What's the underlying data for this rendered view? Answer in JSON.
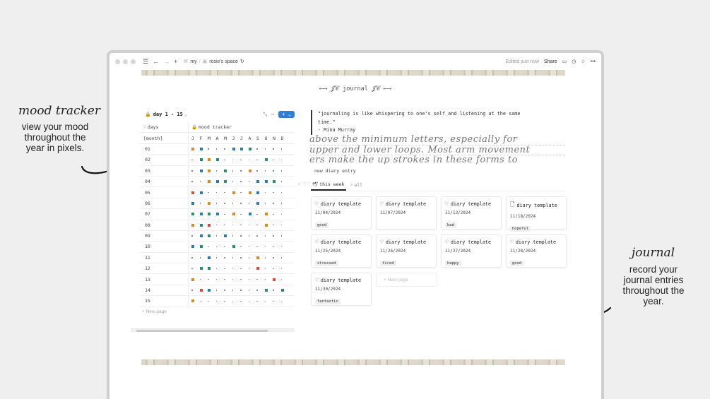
{
  "annotations": {
    "left_title": "mood tracker",
    "left_body": [
      "view your mood",
      "throughout the",
      "year in pixels."
    ],
    "right_title": "journal",
    "right_body": [
      "record your",
      "journal entries",
      "throughout the",
      "year."
    ]
  },
  "topbar": {
    "breadcrumb_1": "my",
    "breadcrumb_sep": "/",
    "breadcrumb_2": "rosie's space",
    "edited": "Edited just now",
    "share": "Share"
  },
  "page_title": "⟵⟶ 𝒥𝒞 journal 𝒥𝒞 ⟵⟶",
  "mood_db": {
    "view_name": "day 1 - 15",
    "new_label": "+",
    "col_days": "days",
    "col_mood": "mood tracker",
    "month_label": "[month]",
    "months": [
      "J",
      "F",
      "M",
      "A",
      "M",
      "J",
      "J",
      "A",
      "S",
      "O",
      "N",
      "D"
    ],
    "rows": [
      {
        "day": "01",
        "cells": [
          "orange",
          "blue",
          ".",
          ".",
          ".",
          "blue",
          "blue",
          "green",
          ".",
          ".",
          ".",
          "."
        ]
      },
      {
        "day": "02",
        "cells": [
          ".",
          "green",
          "orange",
          "green",
          ".",
          ".",
          ".",
          ".",
          ".",
          "green",
          ".",
          "."
        ]
      },
      {
        "day": "03",
        "cells": [
          ".",
          "blue",
          "orange",
          ".",
          "green",
          ".",
          ".",
          "orange",
          ".",
          ".",
          ".",
          "."
        ]
      },
      {
        "day": "04",
        "cells": [
          ".",
          ".",
          "orange",
          "blue",
          "green",
          ".",
          ".",
          ".",
          "blue",
          "blue",
          "green",
          "."
        ]
      },
      {
        "day": "05",
        "cells": [
          "red",
          "blue",
          ".",
          ".",
          ".",
          "orange",
          ".",
          "orange",
          "blue",
          ".",
          ".",
          "."
        ]
      },
      {
        "day": "06",
        "cells": [
          "blue",
          ".",
          "orange",
          ".",
          ".",
          ".",
          ".",
          ".",
          "blue",
          ".",
          ".",
          "."
        ]
      },
      {
        "day": "07",
        "cells": [
          "green",
          "blue",
          "green",
          "blue",
          ".",
          "orange",
          ".",
          "blue",
          ".",
          "orange",
          ".",
          "."
        ]
      },
      {
        "day": "08",
        "cells": [
          "orange",
          "green",
          "red",
          ".",
          ".",
          ".",
          ".",
          ".",
          ".",
          "orange",
          ".",
          "."
        ]
      },
      {
        "day": "09",
        "cells": [
          ".",
          "blue",
          "green",
          ".",
          "blue",
          ".",
          ".",
          ".",
          ".",
          ".",
          ".",
          "."
        ]
      },
      {
        "day": "10",
        "cells": [
          "blue",
          "green",
          ".",
          ".",
          ".",
          "green",
          ".",
          ".",
          ".",
          ".",
          ".",
          "."
        ]
      },
      {
        "day": "11",
        "cells": [
          ".",
          ".",
          "blue",
          ".",
          ".",
          ".",
          ".",
          ".",
          "orange",
          ".",
          ".",
          "."
        ]
      },
      {
        "day": "12",
        "cells": [
          ".",
          "green",
          "green",
          ".",
          ".",
          ".",
          ".",
          ".",
          "red",
          ".",
          ".",
          "."
        ]
      },
      {
        "day": "13",
        "cells": [
          "orange",
          ".",
          ".",
          ".",
          ".",
          ".",
          ".",
          ".",
          ".",
          ".",
          "red",
          "."
        ]
      },
      {
        "day": "14",
        "cells": [
          ".",
          "red",
          "blue",
          ".",
          ".",
          ".",
          ".",
          ".",
          ".",
          "green",
          ".",
          "green"
        ]
      },
      {
        "day": "15",
        "cells": [
          "orange",
          ".",
          ".",
          ".",
          ".",
          ".",
          ".",
          ".",
          ".",
          ".",
          ".",
          "."
        ]
      }
    ],
    "new_page": "+ New page"
  },
  "colors": {
    "orange": "#d9892a",
    "blue": "#2c7bb6",
    "green": "#2e8b6e",
    "red": "#d94c3d",
    "accent": "#2f7fd8"
  },
  "quote": {
    "line1": "\"journaling is like whispering to one's self and listening at the same",
    "line2": "time.\"",
    "line3": "- Mina Murray"
  },
  "script_lines": [
    "above the minimum letters, especially for",
    "upper and lower loops. Most arm movement",
    "ers make the up strokes in these forms to"
  ],
  "journal": {
    "entry_label": "new diary entry",
    "tab_week": "this week",
    "tab_all": "all",
    "cards": [
      {
        "title": "diary template",
        "date": "11/04/2024",
        "tag": "good",
        "icon": "heart-icon"
      },
      {
        "title": "diary template",
        "date": "11/07/2024",
        "tag": "",
        "icon": "heart-icon"
      },
      {
        "title": "diary template",
        "date": "11/13/2024",
        "tag": "bad",
        "icon": "heart-icon"
      },
      {
        "title": "diary template",
        "date": "11/18/2024",
        "tag": "hopeful",
        "icon": "page-icon"
      },
      {
        "title": "diary template",
        "date": "11/25/2024",
        "tag": "stressed",
        "icon": "heart-icon"
      },
      {
        "title": "diary template",
        "date": "11/26/2024",
        "tag": "tired",
        "icon": "heart-icon"
      },
      {
        "title": "diary template",
        "date": "11/27/2024",
        "tag": "happy",
        "icon": "heart-icon"
      },
      {
        "title": "diary template",
        "date": "11/28/2024",
        "tag": "good",
        "icon": "heart-icon"
      },
      {
        "title": "diary template",
        "date": "11/30/2024",
        "tag": "fantastic",
        "icon": "heart-icon"
      }
    ],
    "new_page": "+ New page"
  }
}
